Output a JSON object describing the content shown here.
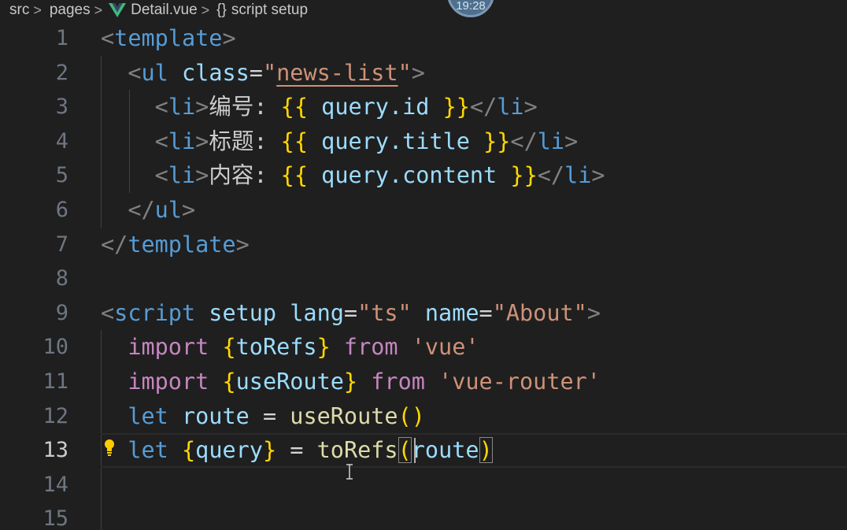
{
  "breadcrumb": {
    "src": "src",
    "pages": "pages",
    "file": "Detail.vue",
    "symbol_braces": "{}",
    "symbol": "script setup"
  },
  "avatar_text": "19:28",
  "gutter": [
    "1",
    "2",
    "3",
    "4",
    "5",
    "6",
    "7",
    "8",
    "9",
    "10",
    "11",
    "12",
    "13",
    "14",
    "15"
  ],
  "code": {
    "l1": [
      "<",
      "template",
      ">"
    ],
    "l2": [
      "<",
      "ul",
      "class",
      "=",
      "\"",
      "news-list",
      "\"",
      ">"
    ],
    "l3": [
      "<",
      "li",
      ">",
      "编号:",
      "{{",
      "query",
      ".id",
      "}}",
      "</",
      "li",
      ">"
    ],
    "l4": [
      "<",
      "li",
      ">",
      "标题:",
      "{{",
      "query",
      ".title",
      "}}",
      "</",
      "li",
      ">"
    ],
    "l5": [
      "<",
      "li",
      ">",
      "内容:",
      "{{",
      "query",
      ".content",
      "}}",
      "</",
      "li",
      ">"
    ],
    "l6": [
      "</",
      "ul",
      ">"
    ],
    "l7": [
      "</",
      "template",
      ">"
    ],
    "l9": [
      "<",
      "script",
      "setup",
      "lang",
      "=",
      "\"ts\"",
      "name",
      "=",
      "\"About\"",
      ">"
    ],
    "l10": [
      "import",
      "{",
      "toRefs",
      "}",
      "from",
      "'vue'"
    ],
    "l11": [
      "import",
      "{",
      "useRoute",
      "}",
      "from",
      "'vue-router'"
    ],
    "l12": [
      "let",
      "route",
      "=",
      "useRoute",
      "()"
    ],
    "l13": [
      "let",
      "{",
      "query",
      "}",
      "=",
      "toRefs",
      "(",
      "route",
      ")"
    ]
  },
  "current_line": 13,
  "colors": {
    "background": "#1f1f1f",
    "tag": "#569cd6",
    "attribute": "#9cdcfe",
    "string": "#ce9178",
    "keyword": "#c586c0",
    "function": "#dcdcaa",
    "bracket": "#ffd700"
  },
  "icons": [
    "vue-icon",
    "chevron-right-icon",
    "lightbulb-icon",
    "text-cursor-icon"
  ]
}
